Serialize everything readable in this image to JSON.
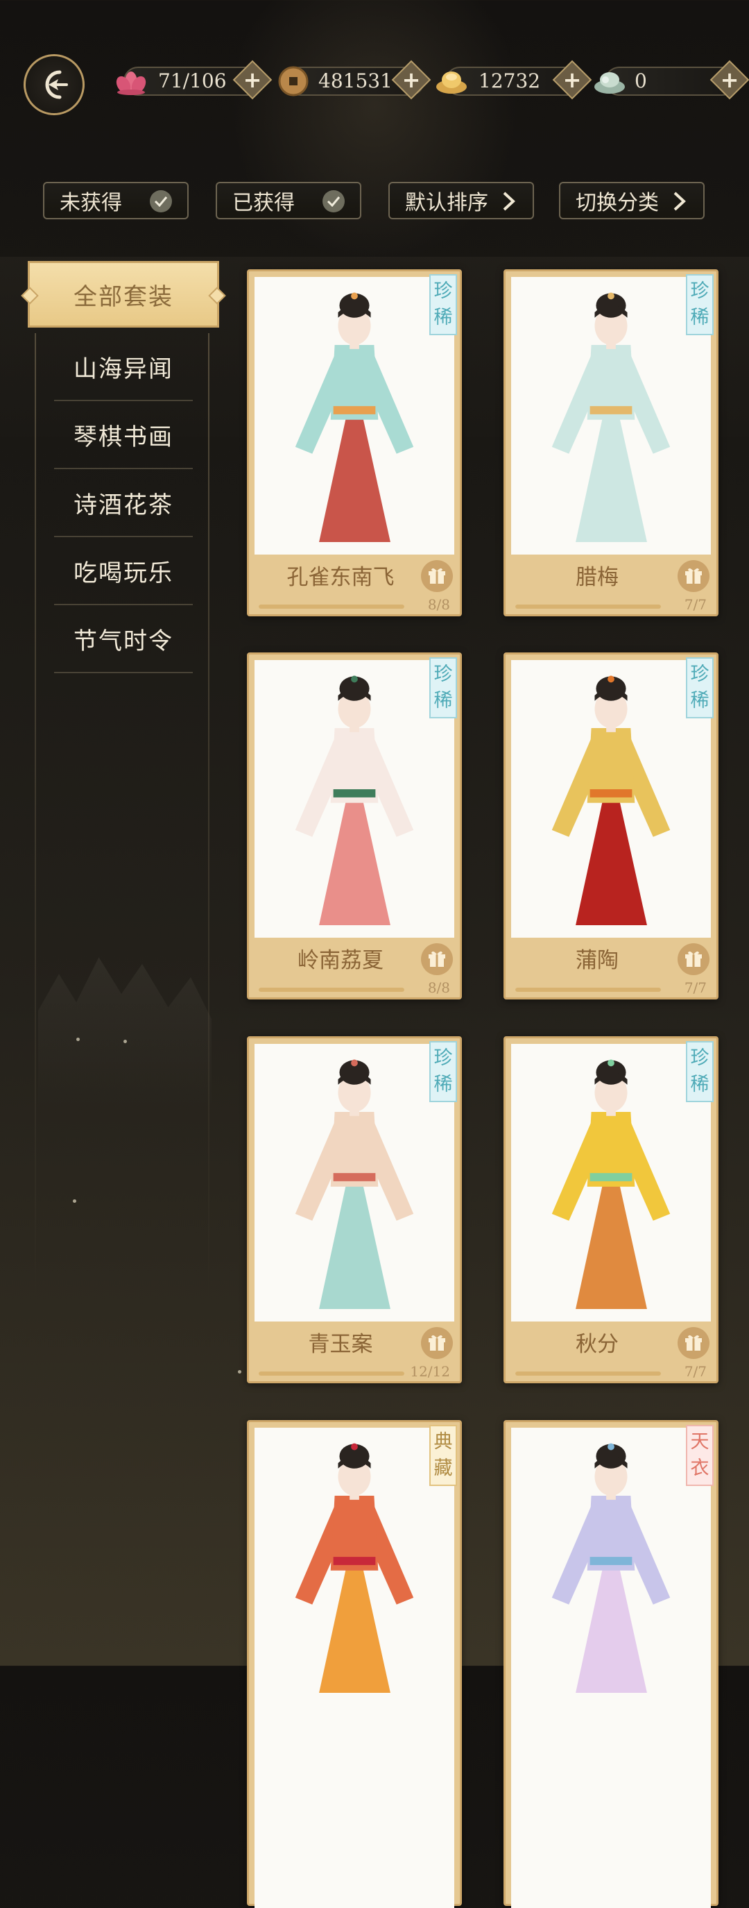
{
  "resources": [
    {
      "icon": "lotus-icon",
      "value": "71/106"
    },
    {
      "icon": "copper-coin-icon",
      "value": "481531"
    },
    {
      "icon": "gold-ingot-icon",
      "value": "12732"
    },
    {
      "icon": "jade-ingot-icon",
      "value": "0"
    }
  ],
  "filters": {
    "not_obtained": "未获得",
    "obtained": "已获得",
    "sort": "默认排序",
    "switch_category": "切换分类"
  },
  "categories": {
    "active": "全部套装",
    "items": [
      "山海异闻",
      "琴棋书画",
      "诗酒花茶",
      "吃喝玩乐",
      "节气时令"
    ]
  },
  "outfits": [
    {
      "name": "孔雀东南飞",
      "rarity": "珍稀",
      "progress": "8/8",
      "fraction": 1.0,
      "colors": {
        "top": "#a9dbd3",
        "skirt": "#c9554a",
        "accent": "#e8a04f"
      }
    },
    {
      "name": "腊梅",
      "rarity": "珍稀",
      "progress": "7/7",
      "fraction": 1.0,
      "colors": {
        "top": "#cde7e2",
        "skirt": "#cde7e2",
        "accent": "#e4b86a"
      }
    },
    {
      "name": "岭南荔夏",
      "rarity": "珍稀",
      "progress": "8/8",
      "fraction": 1.0,
      "colors": {
        "top": "#f6e9e3",
        "skirt": "#e98f8a",
        "accent": "#3f7d5b"
      }
    },
    {
      "name": "蒲陶",
      "rarity": "珍稀",
      "progress": "7/7",
      "fraction": 1.0,
      "colors": {
        "top": "#e8c35c",
        "skirt": "#b8231f",
        "accent": "#e1772b"
      }
    },
    {
      "name": "青玉案",
      "rarity": "珍稀",
      "progress": "12/12",
      "fraction": 1.0,
      "colors": {
        "top": "#f1d6c0",
        "skirt": "#a8d8cf",
        "accent": "#d56c5c"
      }
    },
    {
      "name": "秋分",
      "rarity": "珍稀",
      "progress": "7/7",
      "fraction": 1.0,
      "colors": {
        "top": "#f1c73c",
        "skirt": "#e08a3f",
        "accent": "#7fcf9f"
      }
    },
    {
      "name": "",
      "rarity": "典藏",
      "colors": {
        "top": "#e46c45",
        "skirt": "#f09f3c",
        "accent": "#c8283a"
      }
    },
    {
      "name": "",
      "rarity": "天衣",
      "colors": {
        "top": "#c8c5ea",
        "skirt": "#e4ccec",
        "accent": "#7fb5d8"
      }
    }
  ]
}
